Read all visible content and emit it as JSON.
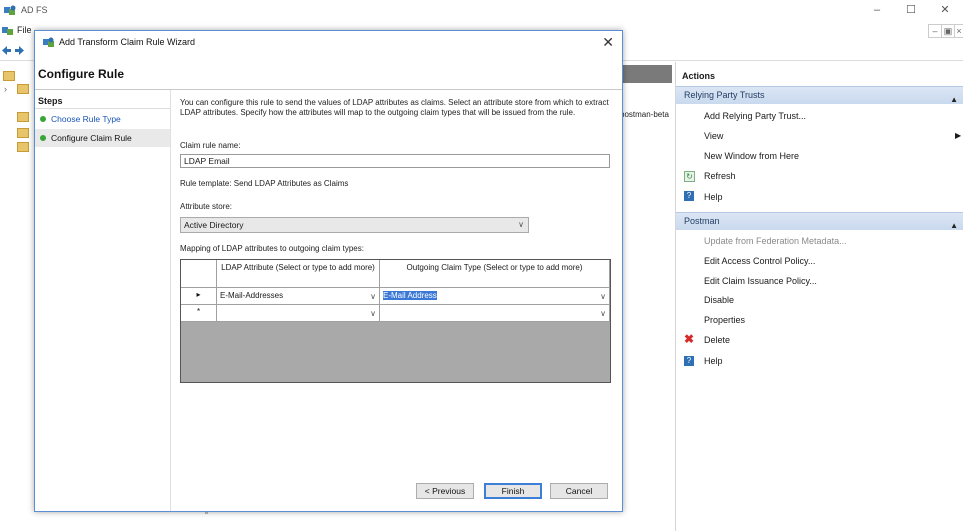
{
  "app": {
    "title": "AD FS"
  },
  "menu": {
    "items": [
      "File"
    ]
  },
  "center": {
    "cell_text": "postman-beta"
  },
  "actions": {
    "title": "Actions",
    "sections": [
      {
        "name": "Relying Party Trusts",
        "items": [
          {
            "label": "Add Relying Party Trust...",
            "icon": ""
          },
          {
            "label": "View",
            "icon": ""
          },
          {
            "label": "New Window from Here",
            "icon": ""
          },
          {
            "label": "Refresh",
            "icon": "refresh-icon"
          },
          {
            "label": "Help",
            "icon": "help-icon"
          }
        ]
      },
      {
        "name": "Postman",
        "items": [
          {
            "label": "Update from Federation Metadata...",
            "icon": "",
            "disabled": true
          },
          {
            "label": "Edit Access Control Policy...",
            "icon": ""
          },
          {
            "label": "Edit Claim Issuance Policy...",
            "icon": ""
          },
          {
            "label": "Disable",
            "icon": ""
          },
          {
            "label": "Properties",
            "icon": ""
          },
          {
            "label": "Delete",
            "icon": "delete-icon"
          },
          {
            "label": "Help",
            "icon": "help-icon"
          }
        ]
      }
    ]
  },
  "dialog": {
    "title": "Add Transform Claim Rule Wizard",
    "header": "Configure Rule",
    "steps_title": "Steps",
    "steps": [
      {
        "label": "Choose Rule Type"
      },
      {
        "label": "Configure Claim Rule"
      }
    ],
    "description": "You can configure this rule to send the values of LDAP attributes as claims. Select an attribute store from which to extract LDAP attributes. Specify how the attributes will map to the outgoing claim types that will be issued from the rule.",
    "claim_rule_name_label": "Claim rule name:",
    "claim_rule_name_value": "LDAP Email",
    "rule_template": "Rule template: Send LDAP Attributes as Claims",
    "attribute_store_label": "Attribute store:",
    "attribute_store_value": "Active Directory",
    "mapping_label": "Mapping of LDAP attributes to outgoing claim types:",
    "grid": {
      "col1": "LDAP Attribute (Select or type to add more)",
      "col2": "Outgoing Claim Type (Select or type to add more)",
      "rows": [
        {
          "marker": "▸",
          "ldap": "E-Mail-Addresses",
          "claim": "E-Mail Address"
        },
        {
          "marker": "*",
          "ldap": "",
          "claim": ""
        }
      ]
    },
    "buttons": {
      "previous": "< Previous",
      "finish": "Finish",
      "cancel": "Cancel"
    }
  },
  "colors": {
    "accent": "#3a78d8",
    "section_header": "#c9d9ee",
    "step_dot": "#37a537"
  }
}
